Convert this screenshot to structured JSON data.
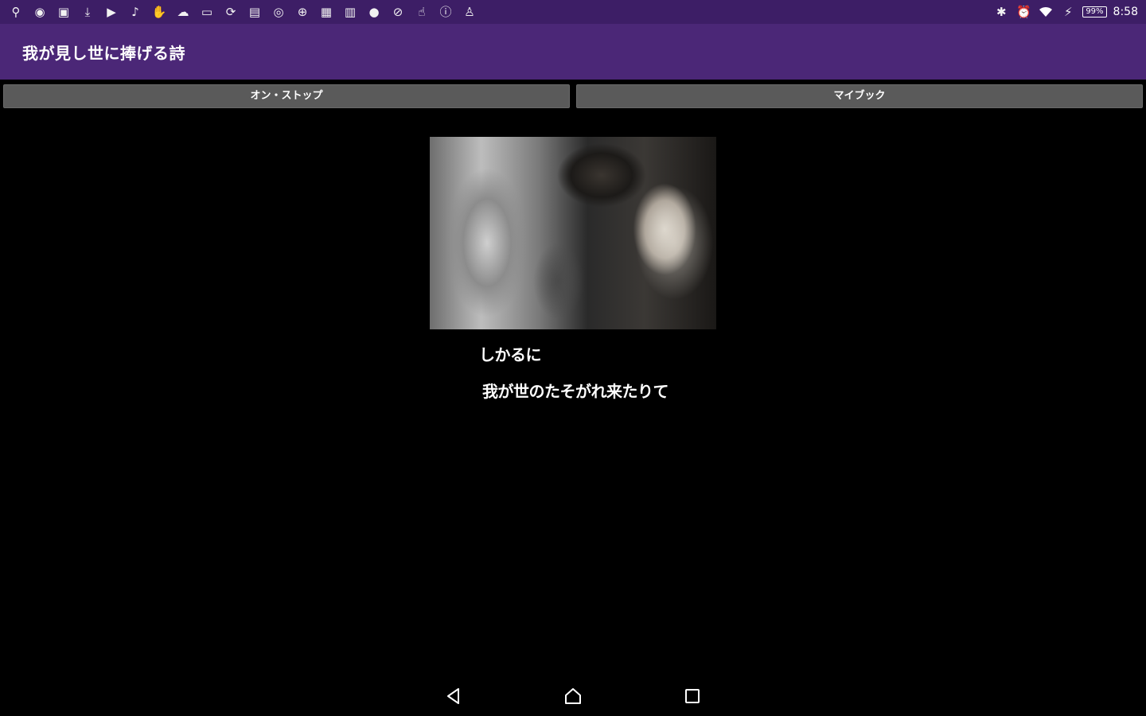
{
  "status_bar": {
    "notification_icons": [
      "usb-icon",
      "chrome-icon",
      "image-icon",
      "download-icon",
      "youtube-icon",
      "mic-icon",
      "hand-icon",
      "cloud-icon",
      "game-icon",
      "sync-icon",
      "cast-icon",
      "globe-icon",
      "plus-circle-icon",
      "keyboard-icon",
      "calendar-icon",
      "info-icon",
      "no-sign-icon",
      "touch-icon",
      "alert-icon",
      "person-icon"
    ],
    "battery": "99%",
    "time": "8:58"
  },
  "app_bar": {
    "title": "我が見し世に捧げる詩"
  },
  "buttons": {
    "left_label": "オン・ストップ",
    "right_label": "マイブック"
  },
  "poem": {
    "line1": "しかるに",
    "line2": "我が世のたそがれ来たりて"
  },
  "nav": {
    "back": "back-icon",
    "home": "home-icon",
    "recents": "recents-icon"
  },
  "colors": {
    "status_bar": "#3d1e66",
    "app_bar": "#4b2777",
    "button": "#5a5a5a",
    "background": "#000000"
  }
}
